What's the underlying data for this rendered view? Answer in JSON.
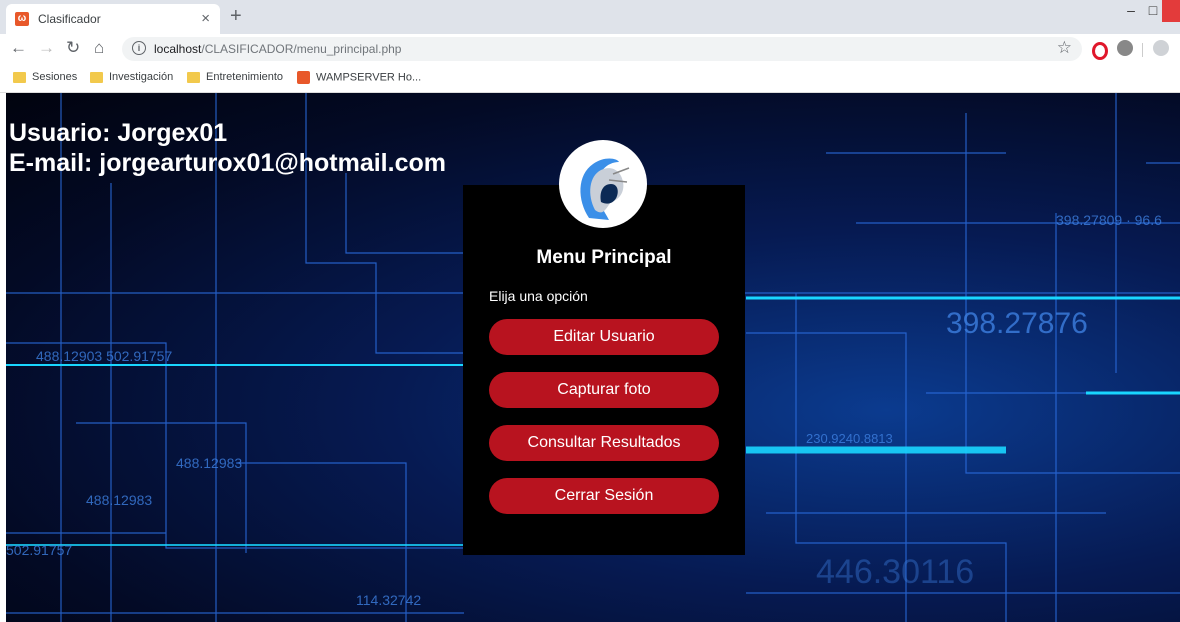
{
  "browser": {
    "tab_title": "Clasificador",
    "tab_close": "×",
    "new_tab": "+",
    "url_host": "localhost",
    "url_path": "/CLASIFICADOR/menu_principal.php",
    "bookmarks": [
      "Sesiones",
      "Investigación",
      "Entretenimiento",
      "WAMPSERVER Ho..."
    ]
  },
  "user": {
    "line1": "Usuario: Jorgex01",
    "line2": "E-mail: jorgearturox01@hotmail.com"
  },
  "menu": {
    "title": "Menu Principal",
    "prompt": "Elija una opción",
    "buttons": [
      "Editar Usuario",
      "Capturar foto",
      "Consultar Resultados",
      "Cerrar Sesión"
    ]
  },
  "colors": {
    "button": "#b8131f",
    "panel": "#000000",
    "accent_lines": "#00bfff"
  }
}
